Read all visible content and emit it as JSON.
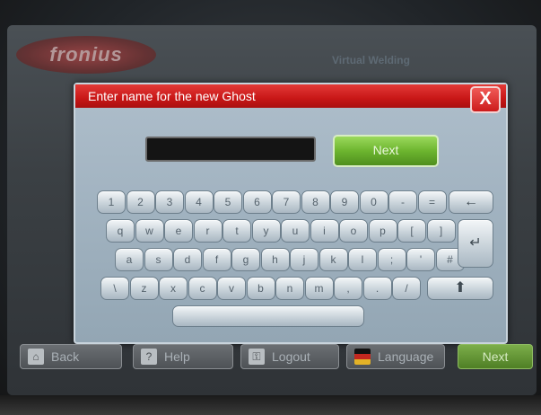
{
  "background": {
    "brand": "fronius",
    "title": "Virtual Welding"
  },
  "dialog": {
    "title": "Enter name for the new Ghost",
    "close_label": "X",
    "input_value": "",
    "next_label": "Next"
  },
  "keyboard": {
    "row1": [
      "1",
      "2",
      "3",
      "4",
      "5",
      "6",
      "7",
      "8",
      "9",
      "0",
      "-",
      "="
    ],
    "row2": [
      "q",
      "w",
      "e",
      "r",
      "t",
      "y",
      "u",
      "i",
      "o",
      "p",
      "[",
      "]"
    ],
    "row3": [
      "a",
      "s",
      "d",
      "f",
      "g",
      "h",
      "j",
      "k",
      "l",
      ";",
      "'",
      "#"
    ],
    "row4": [
      "\\",
      "z",
      "x",
      "c",
      "v",
      "b",
      "n",
      "m",
      ",",
      ".",
      "/"
    ],
    "backspace": "←",
    "enter": "↵",
    "shift": "⬆",
    "space": ""
  },
  "nav": {
    "back_label": "Back",
    "help_label": "Help",
    "logout_label": "Logout",
    "language_label": "Language",
    "next_label": "Next"
  },
  "colors": {
    "titlebar": "#c81717",
    "next_button": "#6db52f",
    "dialog_bg": "#aebecb"
  }
}
